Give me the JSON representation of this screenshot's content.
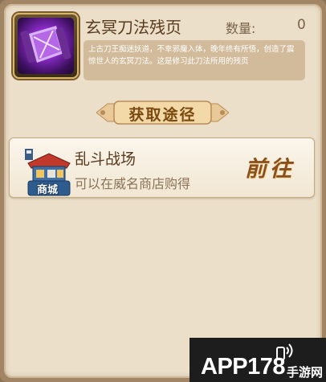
{
  "item": {
    "name": "玄冥刀法残页",
    "quantity_label": "数量:",
    "quantity_value": "0",
    "description": "上古刀王痴迷妖道，不幸邪魔入体，晚年终有所悟，创造了震惊世人的玄冥刀法。这是修习此刀法所用的残页"
  },
  "banner": {
    "label": "获取途径"
  },
  "source": {
    "title": "乱斗战场",
    "subtitle": "可以在威名商店购得",
    "icon_label": "商城",
    "goto_label": "前往"
  },
  "watermark": {
    "brand": "APP178",
    "site": "手游网"
  }
}
